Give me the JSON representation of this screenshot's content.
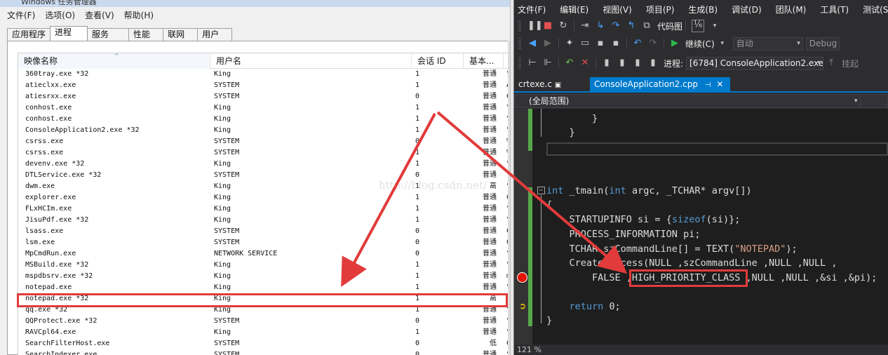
{
  "task_manager": {
    "title": "Windows 任务管理器",
    "menu": [
      "文件(F)",
      "选项(O)",
      "查看(V)",
      "帮助(H)"
    ],
    "tabs": [
      "应用程序",
      "进程",
      "服务",
      "性能",
      "联网",
      "用户"
    ],
    "active_tab": "进程",
    "columns": {
      "name": "映像名称",
      "user": "用户名",
      "session": "会话 ID",
      "priority": "基本...",
      "desc": "命"
    },
    "sort_indicator": "^",
    "rows": [
      {
        "name": "360tray.exe *32",
        "user": "King",
        "session": "1",
        "priority": "普通",
        "desc": "“"
      },
      {
        "name": "atieclxx.exe",
        "user": "SYSTEM",
        "session": "1",
        "priority": "普通",
        "desc": "A"
      },
      {
        "name": "atiesrxx.exe",
        "user": "SYSTEM",
        "session": "0",
        "priority": "普通",
        "desc": "C"
      },
      {
        "name": "conhost.exe",
        "user": "King",
        "session": "1",
        "priority": "普通",
        "desc": "\\"
      },
      {
        "name": "conhost.exe",
        "user": "King",
        "session": "1",
        "priority": "普通",
        "desc": "\\"
      },
      {
        "name": "ConsoleApplication2.exe *32",
        "user": "King",
        "session": "1",
        "priority": "普通",
        "desc": "“"
      },
      {
        "name": "csrss.exe",
        "user": "SYSTEM",
        "session": "0",
        "priority": "普通",
        "desc": "%"
      },
      {
        "name": "csrss.exe",
        "user": "SYSTEM",
        "session": "1",
        "priority": "普通",
        "desc": "%"
      },
      {
        "name": "devenv.exe *32",
        "user": "King",
        "session": "1",
        "priority": "普通",
        "desc": "“"
      },
      {
        "name": "DTLService.exe *32",
        "user": "SYSTEM",
        "session": "0",
        "priority": "普通",
        "desc": "“"
      },
      {
        "name": "dwm.exe",
        "user": "King",
        "session": "1",
        "priority": "高",
        "desc": "“"
      },
      {
        "name": "explorer.exe",
        "user": "King",
        "session": "1",
        "priority": "普通",
        "desc": "C"
      },
      {
        "name": "FLxHCIm.exe",
        "user": "King",
        "session": "1",
        "priority": "普通",
        "desc": "“"
      },
      {
        "name": "JisuPdf.exe *32",
        "user": "King",
        "session": "1",
        "priority": "普通",
        "desc": "“"
      },
      {
        "name": "lsass.exe",
        "user": "SYSTEM",
        "session": "0",
        "priority": "普通",
        "desc": "C"
      },
      {
        "name": "lsm.exe",
        "user": "SYSTEM",
        "session": "0",
        "priority": "普通",
        "desc": "C"
      },
      {
        "name": "MpCmdRun.exe",
        "user": "NETWORK SERVICE",
        "session": "0",
        "priority": "普通",
        "desc": "“"
      },
      {
        "name": "MSBuild.exe *32",
        "user": "King",
        "session": "1",
        "priority": "普通",
        "desc": "“"
      },
      {
        "name": "mspdbsrv.exe *32",
        "user": "King",
        "session": "1",
        "priority": "普通",
        "desc": "m"
      },
      {
        "name": "notepad.exe",
        "user": "King",
        "session": "1",
        "priority": "普通",
        "desc": "“"
      },
      {
        "name": "notepad.exe *32",
        "user": "King",
        "session": "1",
        "priority": "高",
        "desc": "“"
      },
      {
        "name": "qq.exe *32",
        "user": "King",
        "session": "1",
        "priority": "普通",
        "desc": "“"
      },
      {
        "name": "QQProtect.exe *32",
        "user": "SYSTEM",
        "session": "0",
        "priority": "普通",
        "desc": "“"
      },
      {
        "name": "RAVCpl64.exe",
        "user": "King",
        "session": "1",
        "priority": "普通",
        "desc": "“"
      },
      {
        "name": "SearchFilterHost.exe",
        "user": "SYSTEM",
        "session": "0",
        "priority": "低",
        "desc": "C"
      },
      {
        "name": "SearchIndexer.exe",
        "user": "SYSTEM",
        "session": "0",
        "priority": "普通",
        "desc": "“"
      }
    ]
  },
  "visual_studio": {
    "menu": [
      "文件(F)",
      "编辑(E)",
      "视图(V)",
      "项目(P)",
      "生成(B)",
      "调试(D)",
      "团队(M)",
      "工具(T)",
      "测试(S)"
    ],
    "toolbar1": {
      "code_map": "代码图"
    },
    "toolbar2": {
      "continue": "继续(C)",
      "auto_combo": "自动",
      "config_combo": "Debug"
    },
    "toolbar3": {
      "process_label": "进程:",
      "process_value": "[6784] ConsoleApplication2.exe",
      "hang_label": "挂起"
    },
    "doc_tabs": {
      "tab1": "crtexe.c",
      "tab2": "ConsoleApplication2.cpp"
    },
    "scope": "(全局范围)",
    "code_lines": [
      {
        "id": "l1",
        "text": "        }"
      },
      {
        "id": "l2",
        "text": "    }"
      },
      {
        "id": "l3",
        "text": ""
      },
      {
        "id": "l4",
        "text": ""
      },
      {
        "id": "l5",
        "text": ""
      },
      {
        "id": "l6",
        "text": "int _tmain(int argc, _TCHAR* argv[])"
      },
      {
        "id": "l7",
        "text": "{"
      },
      {
        "id": "l8",
        "text": "    STARTUPINFO si = {sizeof(si)};"
      },
      {
        "id": "l9",
        "text": "    PROCESS_INFORMATION pi;"
      },
      {
        "id": "l10",
        "text": "    TCHAR szCommandLine[] = TEXT(\"NOTEPAD\");"
      },
      {
        "id": "l11",
        "text": "    CreateProcess(NULL ,szCommandLine ,NULL ,NULL ,"
      },
      {
        "id": "l12",
        "text": "        FALSE ,HIGH_PRIORITY_CLASS ,NULL ,NULL ,&si ,&pi);"
      },
      {
        "id": "l13",
        "text": ""
      },
      {
        "id": "l14",
        "text": "    return 0;"
      },
      {
        "id": "l15",
        "text": "}"
      }
    ],
    "zoom": "121 %"
  },
  "watermark": "http://blog.csdn.net/",
  "colors": {
    "annotation_red": "#e23b3b",
    "vs_accent": "#007acc",
    "breakpoint": "#e51400"
  }
}
